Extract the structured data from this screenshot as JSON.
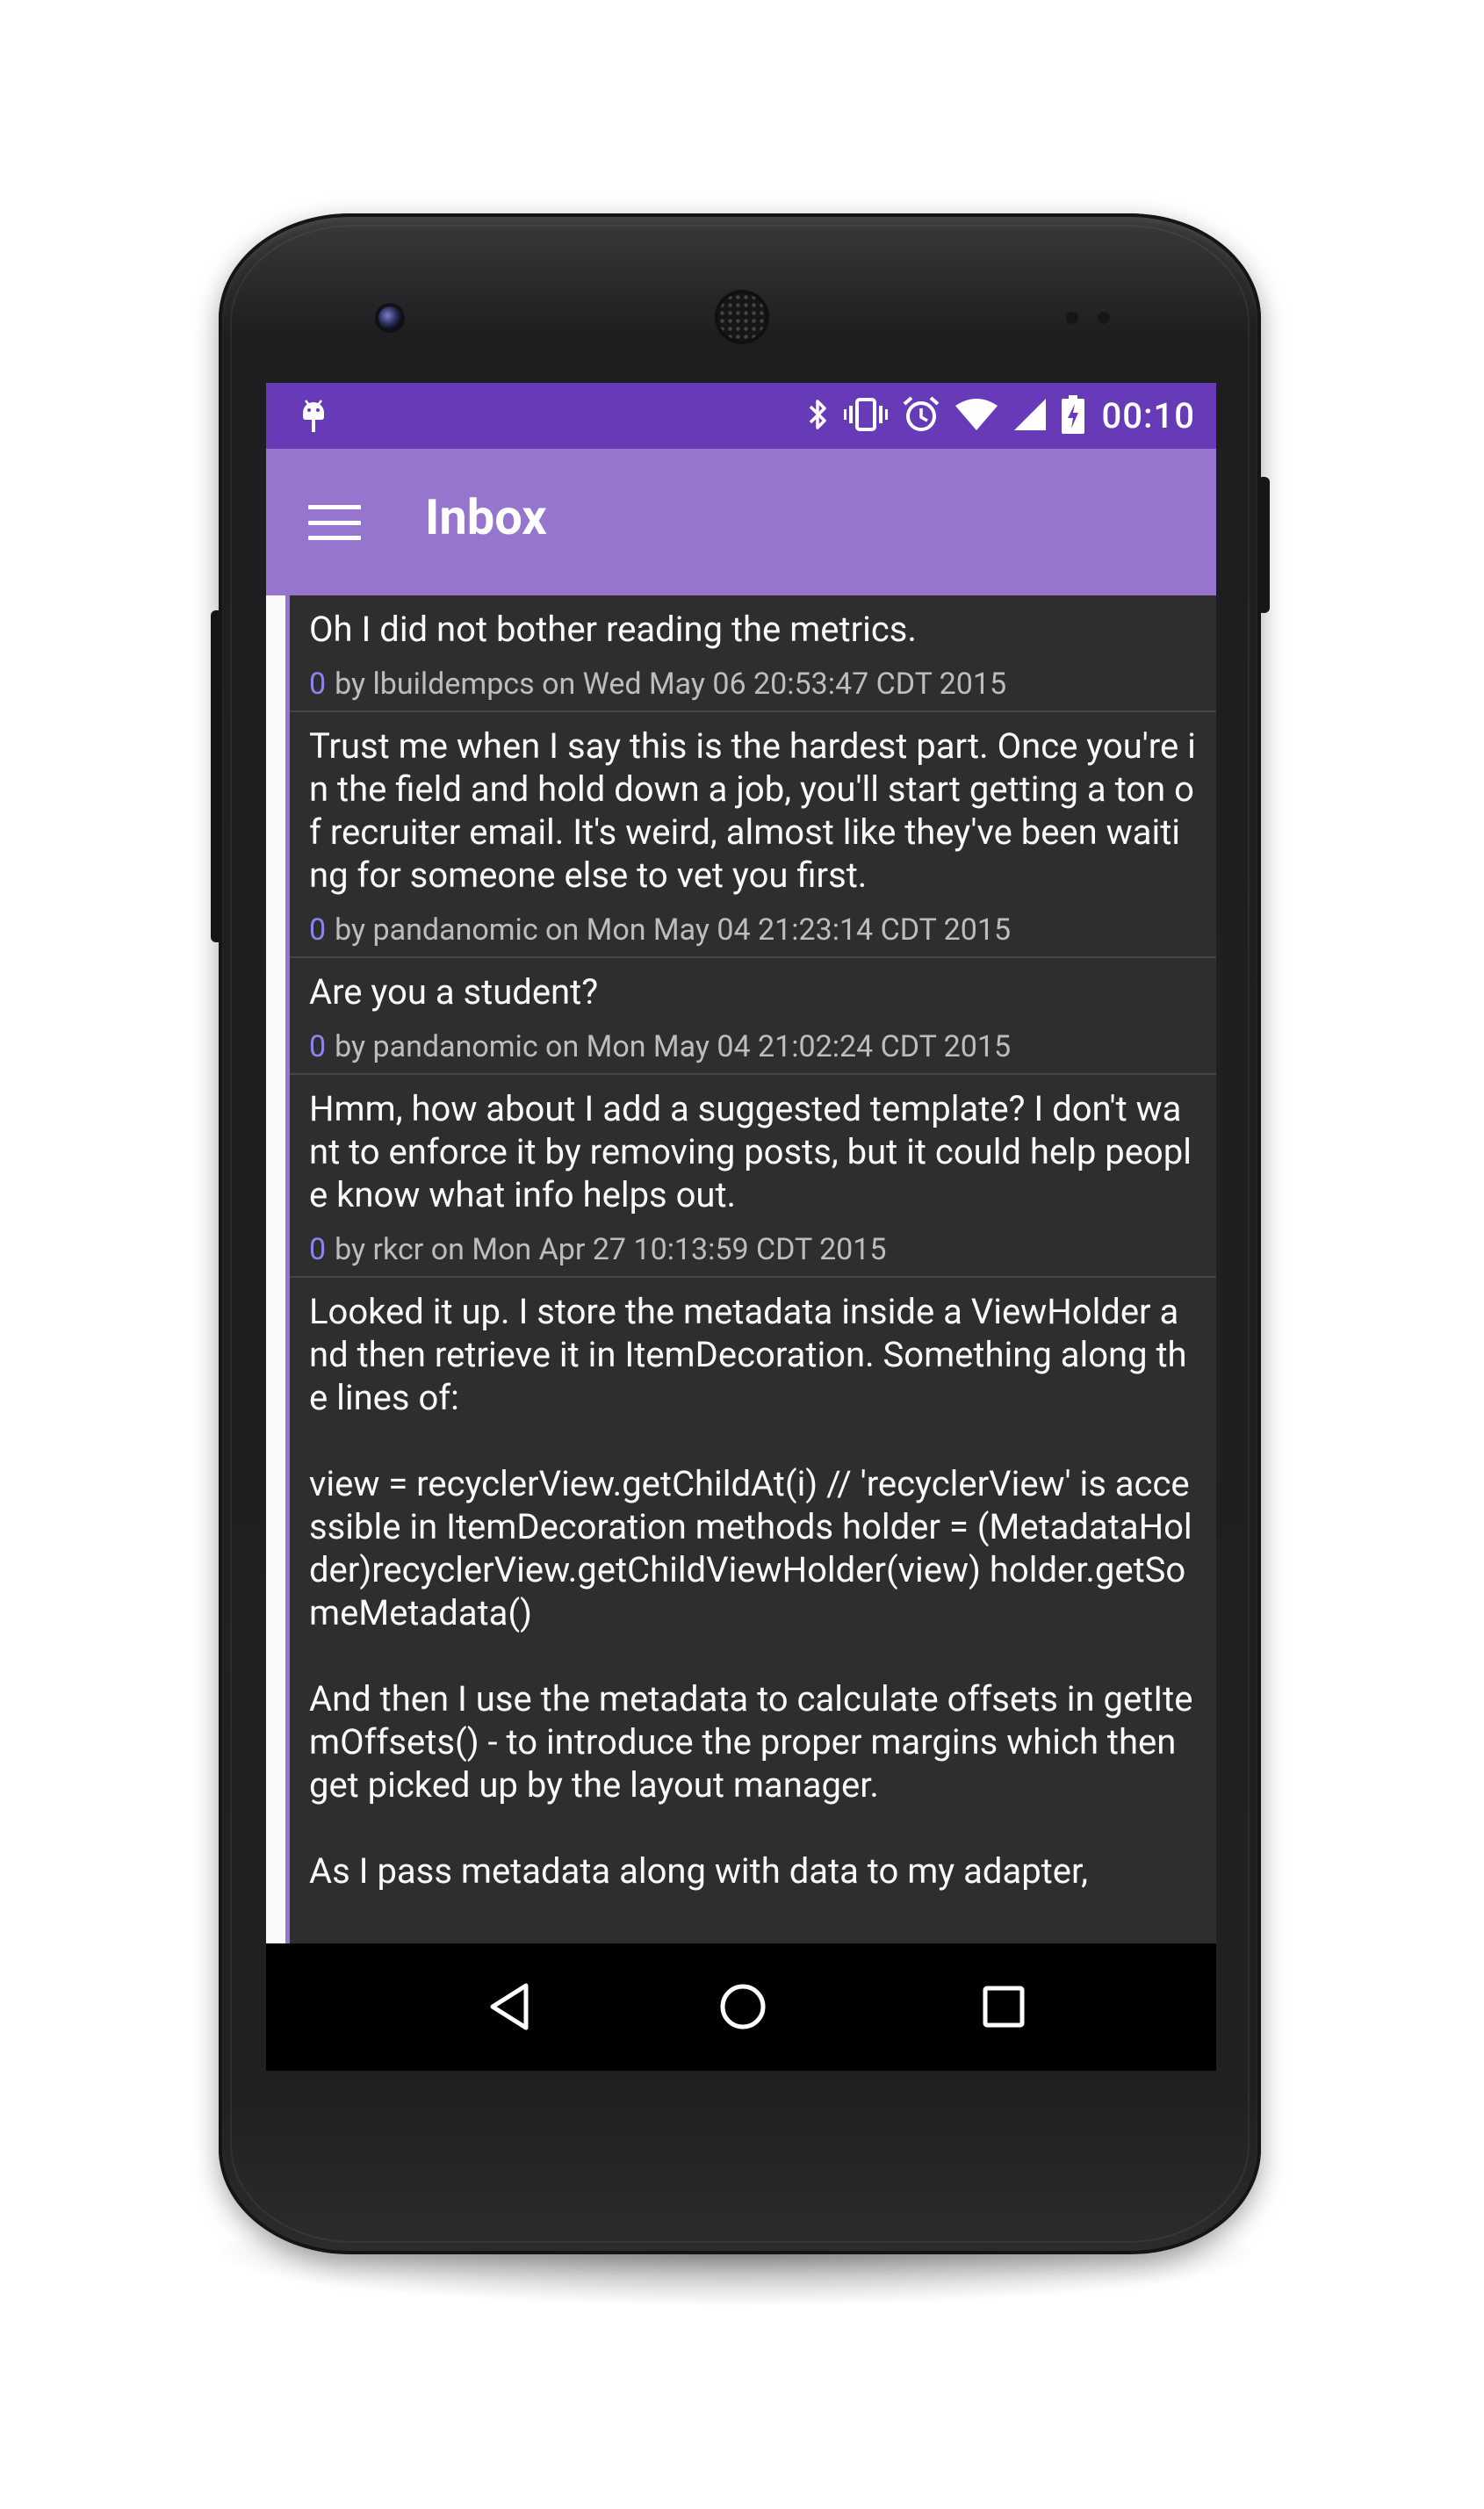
{
  "status_bar": {
    "time": "00:10",
    "left_icon": "android-debug-icon",
    "right_icons": [
      "bluetooth-icon",
      "vibrate-icon",
      "alarm-icon",
      "wifi-icon",
      "signal-icon",
      "battery-charging-icon"
    ]
  },
  "app_bar": {
    "title": "Inbox",
    "menu_icon": "menu-icon"
  },
  "colors": {
    "status_bar": "#673ab7",
    "app_bar": "#9575cd",
    "background": "#2e2e2e",
    "score": "#8c84ee",
    "meta_text": "#bdbdbd",
    "body_text": "#fafafa"
  },
  "messages": [
    {
      "body": "Oh I did not bother reading the metrics.",
      "score": "0",
      "meta": "by lbuildempcs on Wed May 06 20:53:47 CDT 2015"
    },
    {
      "body": "Trust me when I say this is the hardest part. Once you're in the field and hold down a job, you'll start getting a ton of recruiter email. It's weird, almost like they've been waiting for someone else to vet you first.",
      "score": "0",
      "meta": "by pandanomic on Mon May 04 21:23:14 CDT 2015"
    },
    {
      "body": "Are you a student?",
      "score": "0",
      "meta": "by pandanomic on Mon May 04 21:02:24 CDT 2015"
    },
    {
      "body": "Hmm, how about I add a suggested template? I don't want to enforce it by removing posts, but it could help people know what info helps out.",
      "score": "0",
      "meta": "by rkcr on Mon Apr 27 10:13:59 CDT 2015"
    },
    {
      "body": "Looked it up. I store the metadata inside a ViewHolder and then retrieve it in ItemDecoration. Something along the lines of:\n\nview = recyclerView.getChildAt(i) // 'recyclerView' is accessible in ItemDecoration methods holder = (MetadataHolder)recyclerView.getChildViewHolder(view) holder.getSomeMetadata()\n\nAnd then I use the metadata to calculate offsets in getItemOffsets() - to introduce the proper margins which then get picked up by the layout manager.\n\nAs I pass metadata along with data to my adapter,",
      "score": "",
      "meta": ""
    }
  ],
  "nav_bar": {
    "back_icon": "back-triangle-icon",
    "home_icon": "home-circle-icon",
    "recents_icon": "recents-square-icon"
  }
}
